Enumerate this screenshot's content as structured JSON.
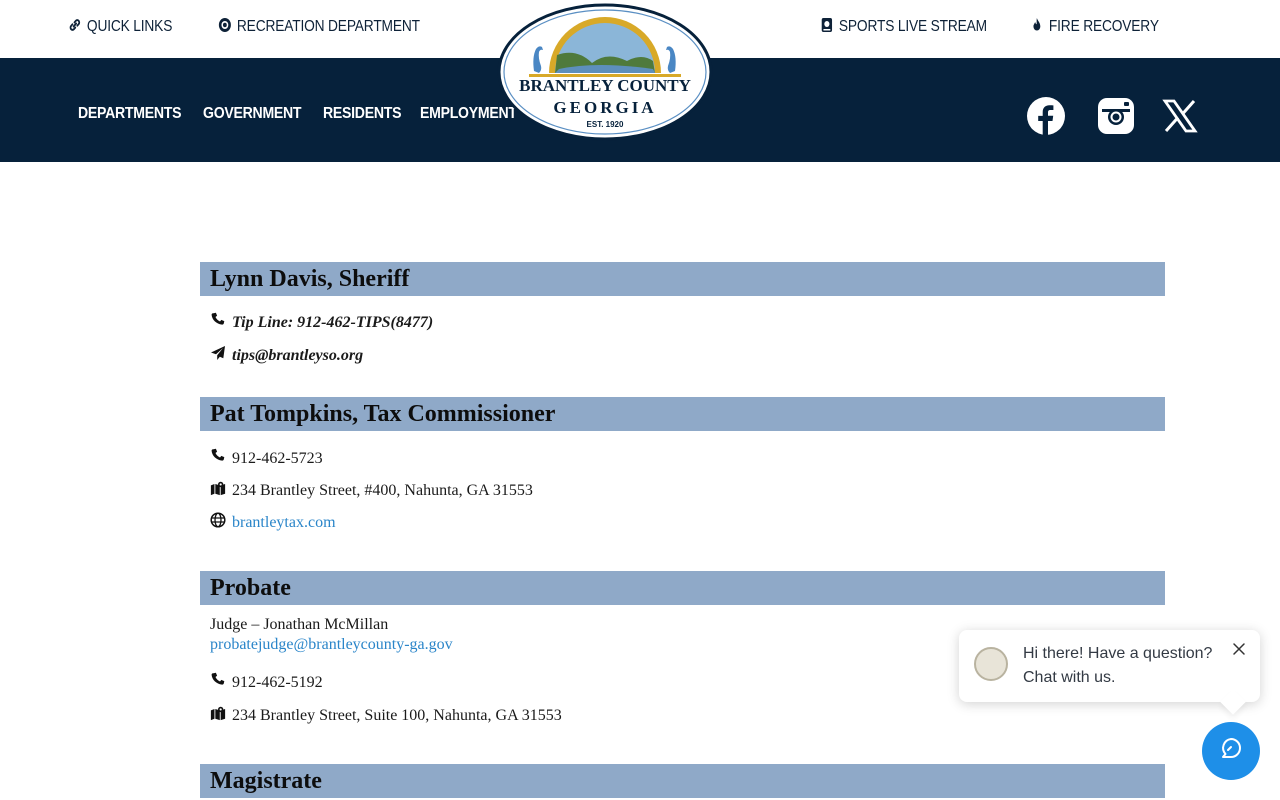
{
  "topbar": {
    "links": [
      {
        "label": "QUICK LINKS",
        "icon": "link-icon"
      },
      {
        "label": "RECREATION DEPARTMENT",
        "icon": "target-icon"
      },
      {
        "label": "SPORTS LIVE STREAM",
        "icon": "video-icon"
      },
      {
        "label": "FIRE RECOVERY",
        "icon": "flame-icon"
      }
    ]
  },
  "logo": {
    "line1": "BRANTLEY COUNTY",
    "line2": "GEORGIA",
    "est": "EST. 1920"
  },
  "nav": {
    "items": [
      "DEPARTMENTS",
      "GOVERNMENT",
      "RESIDENTS",
      "EMPLOYMENT"
    ]
  },
  "social": [
    "facebook-icon",
    "instagram-icon",
    "x-icon"
  ],
  "sections": {
    "sheriff": {
      "title": "Lynn Davis, Sheriff",
      "tip_line": "Tip Line: 912-462-TIPS(8477)",
      "email": "tips@brantleyso.org"
    },
    "tax": {
      "title": "Pat Tompkins, Tax Commissioner",
      "phone": "912-462-5723",
      "address": "234 Brantley Street, #400, Nahunta, GA 31553",
      "website": "brantleytax.com"
    },
    "probate": {
      "title": "Probate",
      "judge": "Judge – Jonathan McMillan",
      "email": "probatejudge@brantleycounty-ga.gov",
      "phone": "912-462-5192",
      "address": "234 Brantley Street, Suite 100, Nahunta, GA 31553"
    },
    "magistrate": {
      "title": "Magistrate"
    }
  },
  "chat": {
    "line1": "Hi there! Have a question?",
    "line2": "Chat with us."
  },
  "colors": {
    "navy": "#06213b",
    "section_header": "#8fa9c8",
    "link": "#2a85c9",
    "chat_button": "#1e8fe8"
  }
}
